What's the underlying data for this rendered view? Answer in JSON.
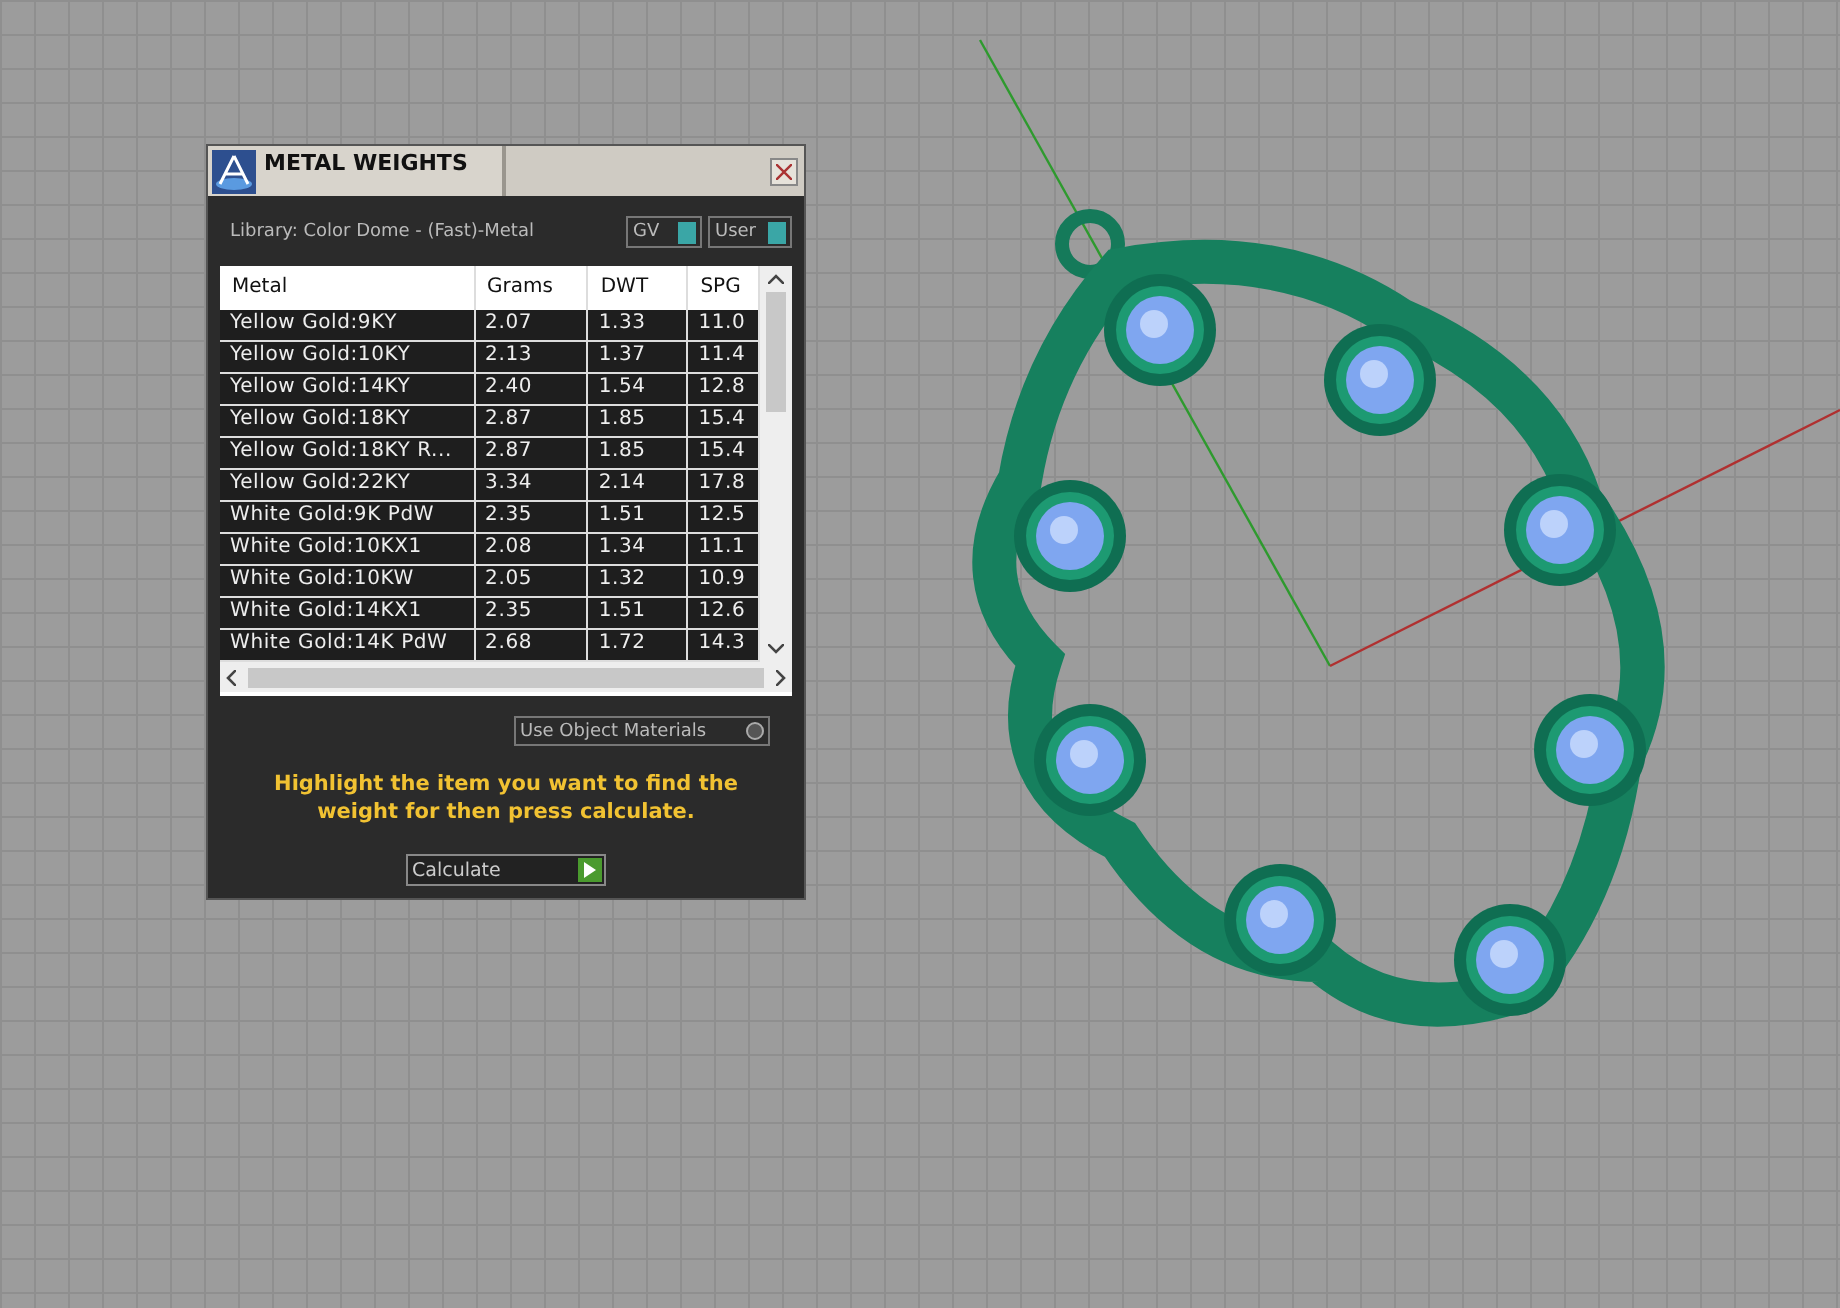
{
  "dialog": {
    "title": "METAL WEIGHTS",
    "library": "Library: Color Dome - (Fast)-Metal",
    "toggles": [
      {
        "label": "GV",
        "on": true
      },
      {
        "label": "User",
        "on": true
      }
    ],
    "table": {
      "columns": [
        "Metal",
        "Grams",
        "DWT",
        "SPG"
      ],
      "rows": [
        [
          "Yellow Gold:9KY",
          "2.07",
          "1.33",
          "11.0"
        ],
        [
          "Yellow Gold:10KY",
          "2.13",
          "1.37",
          "11.4"
        ],
        [
          "Yellow Gold:14KY",
          "2.40",
          "1.54",
          "12.8"
        ],
        [
          "Yellow Gold:18KY",
          "2.87",
          "1.85",
          "15.4"
        ],
        [
          "Yellow Gold:18KY R...",
          "2.87",
          "1.85",
          "15.4"
        ],
        [
          "Yellow Gold:22KY",
          "3.34",
          "2.14",
          "17.8"
        ],
        [
          "White Gold:9K PdW",
          "2.35",
          "1.51",
          "12.5"
        ],
        [
          "White Gold:10KX1",
          "2.08",
          "1.34",
          "11.1"
        ],
        [
          "White Gold:10KW",
          "2.05",
          "1.32",
          "10.9"
        ],
        [
          "White Gold:14KX1",
          "2.35",
          "1.51",
          "12.6"
        ],
        [
          "White Gold:14K PdW",
          "2.68",
          "1.72",
          "14.3"
        ]
      ]
    },
    "object_materials": {
      "label": "Use Object Materials",
      "on": false
    },
    "hint": "Highlight the item you want to find the weight for then press calculate.",
    "calculate": "Calculate"
  }
}
